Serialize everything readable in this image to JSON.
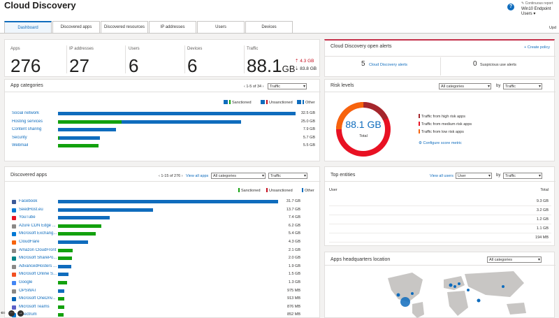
{
  "header": {
    "title": "Cloud Discovery",
    "report_sub": "Continuous report",
    "report_name": "Win10 Endpoint Users",
    "update_text": "Upd"
  },
  "tabs": [
    "Dashboard",
    "Discovered apps",
    "Discovered resources",
    "IP addresses",
    "Users",
    "Devices"
  ],
  "stats": {
    "apps": {
      "label": "Apps",
      "value": "276"
    },
    "ips": {
      "label": "IP addresses",
      "value": "27"
    },
    "users": {
      "label": "Users",
      "value": "6"
    },
    "devices": {
      "label": "Devices",
      "value": "6"
    },
    "traffic": {
      "label": "Traffic",
      "value": "88.1",
      "unit": "GB",
      "up": "4.3 GB",
      "down": "83.8 GB"
    }
  },
  "alerts": {
    "title": "Cloud Discovery open alerts",
    "create_policy": "+ Create policy",
    "cd_count": "5",
    "cd_label": "Cloud Discovery alerts",
    "sus_count": "0",
    "sus_label": "Suspicious use alerts"
  },
  "categories": {
    "title": "App categories",
    "pager": "1-5 of 34",
    "metric": "Traffic",
    "legend": {
      "sanctioned": "Sanctioned",
      "unsanctioned": "Unsanctioned",
      "other": "Other"
    },
    "items": [
      {
        "label": "Social network",
        "value": "32.5 GB",
        "sanctioned": 0,
        "other": 32.5
      },
      {
        "label": "Hosting services",
        "value": "25.0 GB",
        "sanctioned": 8.7,
        "other": 16.3
      },
      {
        "label": "Content sharing",
        "value": "7.9 GB",
        "sanctioned": 0,
        "other": 7.9
      },
      {
        "label": "Security",
        "value": "5.7 GB",
        "sanctioned": 0.2,
        "other": 5.5
      },
      {
        "label": "Webmail",
        "value": "5.5 GB",
        "sanctioned": 5.5,
        "other": 0
      }
    ]
  },
  "risk": {
    "title": "Risk levels",
    "category_select": "All categories",
    "by": "by",
    "metric": "Traffic",
    "total_value": "88.1 GB",
    "total_label": "Total",
    "legend": [
      "Traffic from high risk apps",
      "Traffic from medium risk apps",
      "Traffic from low risk apps"
    ],
    "link": "Configure score metric",
    "high_color": "#a4262c",
    "medium_color": "#e81123",
    "low_color": "#f7630c"
  },
  "discovered": {
    "title": "Discovered apps",
    "pager": "1-15 of 276",
    "view_all": "View all apps",
    "category_select": "All categories",
    "metric": "Traffic",
    "legend": {
      "sanctioned": "Sanctioned",
      "unsanctioned": "Unsanctioned",
      "other": "Other"
    },
    "items": [
      {
        "label": "Facebook",
        "value": "31.7 GB",
        "gb": 31.7,
        "type": "other",
        "icon": "#3b5998"
      },
      {
        "label": "SeedHost.eu",
        "value": "13.7 GB",
        "gb": 13.7,
        "type": "other",
        "icon": "#0078d4"
      },
      {
        "label": "YouTube",
        "value": "7.4 GB",
        "gb": 7.4,
        "type": "other",
        "icon": "#e81123"
      },
      {
        "label": "Azure CDN Edge ...",
        "value": "6.2 GB",
        "gb": 6.2,
        "type": "sanctioned",
        "icon": "#8a8886"
      },
      {
        "label": "Microsoft Exchang...",
        "value": "5.4 GB",
        "gb": 5.4,
        "type": "sanctioned",
        "icon": "#0078d4"
      },
      {
        "label": "CloudFlare",
        "value": "4.3 GB",
        "gb": 4.3,
        "type": "other",
        "icon": "#f7630c"
      },
      {
        "label": "Amazon CloudFront",
        "value": "2.1 GB",
        "gb": 2.1,
        "type": "sanctioned",
        "icon": "#8a8886"
      },
      {
        "label": "Microsoft SharePo...",
        "value": "2.0 GB",
        "gb": 2.0,
        "type": "sanctioned",
        "icon": "#038387"
      },
      {
        "label": "AdvancedHosters ...",
        "value": "1.9 GB",
        "gb": 1.9,
        "type": "other",
        "icon": "#8a8886"
      },
      {
        "label": "Microsoft Online S...",
        "value": "1.5 GB",
        "gb": 1.5,
        "type": "other",
        "icon": "#f25022"
      },
      {
        "label": "Google",
        "value": "1.3 GB",
        "gb": 1.3,
        "type": "sanctioned",
        "icon": "#4285f4"
      },
      {
        "label": "OPSWAT",
        "value": "975 MB",
        "gb": 0.95,
        "type": "other",
        "icon": "#8a8886"
      },
      {
        "label": "Microsoft OneDriv...",
        "value": "913 MB",
        "gb": 0.89,
        "type": "sanctioned",
        "icon": "#0364b8"
      },
      {
        "label": "Microsoft Teams",
        "value": "876 MB",
        "gb": 0.86,
        "type": "sanctioned",
        "icon": "#5b5fc7"
      },
      {
        "label": "Spectrum",
        "value": "852 MB",
        "gb": 0.83,
        "type": "sanctioned",
        "icon": "#0078d4"
      }
    ]
  },
  "top_entities": {
    "title": "Top entities",
    "view_all": "View all users",
    "entity_select": "User",
    "by": "by",
    "metric": "Traffic",
    "col_user": "User",
    "col_total": "Total",
    "rows": [
      "9.3 GB",
      "3.2 GB",
      "1.2 GB",
      "1.1 GB",
      "194 MB"
    ]
  },
  "hq": {
    "title": "Apps headquarters location",
    "category_select": "All categories"
  },
  "colors": {
    "accent": "#0f6cbd",
    "sanctioned": "#13a10e",
    "unsanctioned": "#c50f1f",
    "other": "#0f6cbd"
  }
}
